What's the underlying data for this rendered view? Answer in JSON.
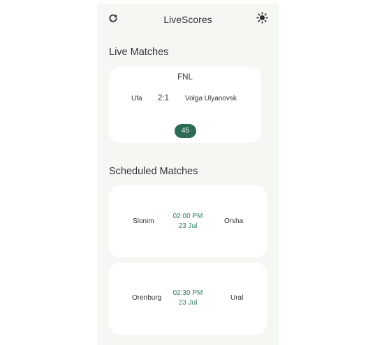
{
  "header": {
    "title": "LiveScores",
    "refresh_icon": "refresh-icon",
    "theme_icon": "sun-icon"
  },
  "live": {
    "section_title": "Live Matches",
    "matches": [
      {
        "league": "FNL",
        "home": "Ufa",
        "score": "2:1",
        "away": "Volga Ulyanovsk",
        "minute": "45"
      }
    ]
  },
  "scheduled": {
    "section_title": "Scheduled Matches",
    "matches": [
      {
        "home": "Slonim",
        "time": "02:00 PM",
        "date": "23 Jul",
        "away": "Orsha"
      },
      {
        "home": "Orenburg",
        "time": "02:30 PM",
        "date": "23 Jul",
        "away": "Ural"
      }
    ]
  },
  "colors": {
    "accent": "#2e6b54",
    "time_text": "#2e7b66",
    "app_background": "#f4f7f2",
    "card_background": "#ffffff"
  }
}
